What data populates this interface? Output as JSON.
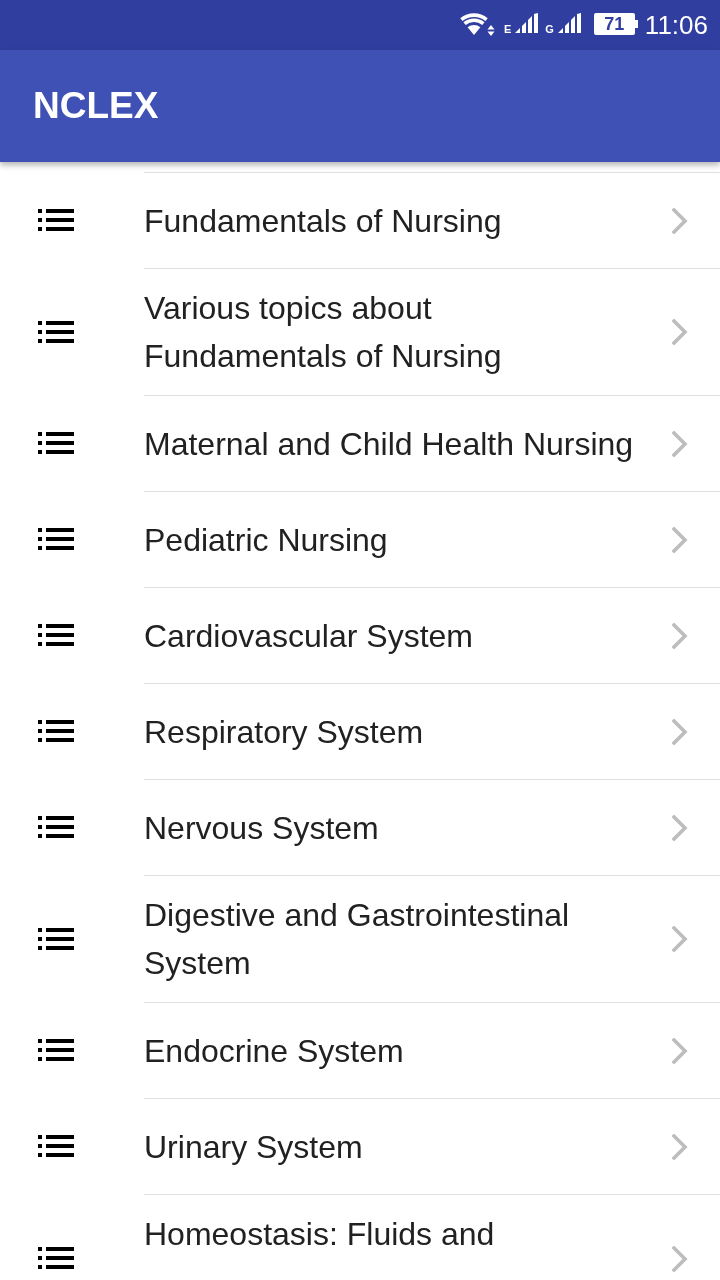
{
  "status_bar": {
    "network_1": "E",
    "network_2": "G",
    "battery": "71",
    "time": "11:06"
  },
  "app_bar": {
    "title": "NCLEX"
  },
  "topics": [
    {
      "title": "Fundamentals of Nursing"
    },
    {
      "title": "Various topics about Fundamentals of Nursing"
    },
    {
      "title": "Maternal and Child Health Nursing"
    },
    {
      "title": "Pediatric Nursing"
    },
    {
      "title": "Cardiovascular System"
    },
    {
      "title": "Respiratory System"
    },
    {
      "title": "Nervous System"
    },
    {
      "title": "Digestive and Gastrointestinal System"
    },
    {
      "title": "Endocrine System"
    },
    {
      "title": "Urinary System"
    },
    {
      "title": "Homeostasis: Fluids and"
    }
  ]
}
